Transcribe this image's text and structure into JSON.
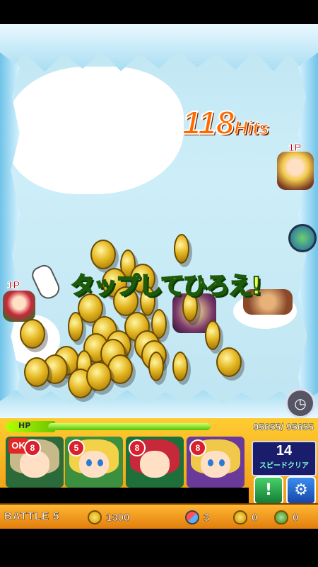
{
  "combo": {
    "count": "118",
    "label": "Hits"
  },
  "message": "タップしてひろえ!",
  "player_marker": "1P",
  "hp": {
    "label": "HP",
    "current": "95655",
    "max": "95655",
    "text": "95655/ 95655",
    "fraction": 1.0
  },
  "team": [
    {
      "name": "slot-1",
      "level": "8",
      "ok_label": "OK",
      "hair": "#c7b98a",
      "bg": "#2b6b3a"
    },
    {
      "name": "slot-2",
      "level": "5",
      "hair": "#f3d24a",
      "bg": "#3b8f3f"
    },
    {
      "name": "slot-3",
      "level": "8",
      "hair": "#c7283a",
      "bg": "#1f6f3b"
    },
    {
      "name": "slot-4",
      "level": "8",
      "hair": "#f0c94a",
      "bg": "#6a3a9a"
    }
  ],
  "speed_clear": {
    "value": "14",
    "label": "スピードクリア"
  },
  "buttons": {
    "help": "!",
    "settings": "⚙"
  },
  "status": {
    "battle": "BATTLE 5",
    "gold": "1300",
    "items": "3",
    "eggs_gold": "0",
    "eggs_green": "0"
  },
  "icons": {
    "coin": "gold-coin-icon",
    "capsule": "capsule-icon",
    "gold_egg": "gold-egg-icon",
    "green_egg": "green-egg-icon",
    "gear": "gear-icon",
    "clock": "clock-icon"
  }
}
